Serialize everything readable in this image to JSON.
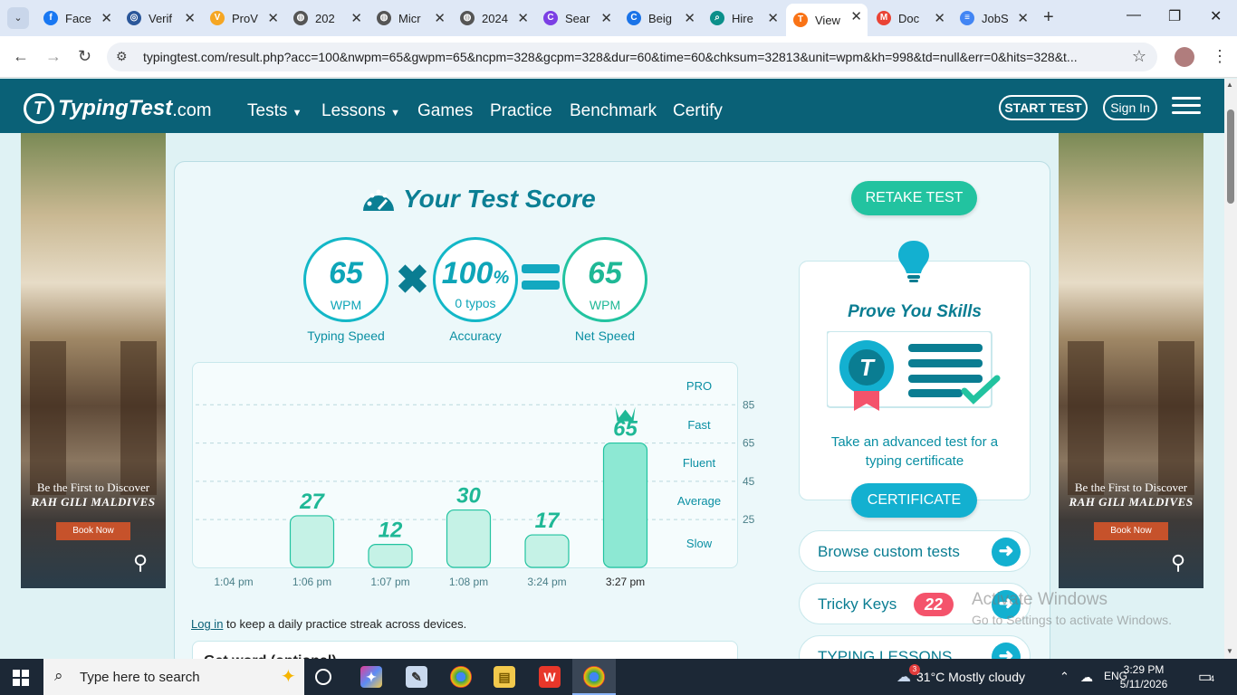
{
  "browser": {
    "tabs": [
      {
        "label": "Face",
        "color": "#1877f2",
        "glyph": "f"
      },
      {
        "label": "Verif",
        "color": "#2b579a",
        "glyph": "◎"
      },
      {
        "label": "ProV",
        "color": "#f5a623",
        "glyph": "V"
      },
      {
        "label": "202",
        "color": "#555555",
        "glyph": "◍"
      },
      {
        "label": "Micr",
        "color": "#555555",
        "glyph": "◍"
      },
      {
        "label": "2024",
        "color": "#555555",
        "glyph": "◍"
      },
      {
        "label": "Sear",
        "color": "#7b3fe4",
        "glyph": "C"
      },
      {
        "label": "Beig",
        "color": "#1a73e8",
        "glyph": "C"
      },
      {
        "label": "Hire",
        "color": "#0b8f8a",
        "glyph": "⌕"
      },
      {
        "label": "View",
        "color": "#f97316",
        "glyph": "T"
      },
      {
        "label": "Doc",
        "color": "#ea4335",
        "glyph": "M"
      },
      {
        "label": "JobS",
        "color": "#4285f4",
        "glyph": "≡"
      }
    ],
    "url": "typingtest.com/result.php?acc=100&nwpm=65&gwpm=65&ncpm=328&gcpm=328&dur=60&time=60&chksum=32813&unit=wpm&kh=998&td=null&err=0&hits=328&t..."
  },
  "site": {
    "logo_text": "TypingTest",
    "logo_domain": ".com",
    "nav": [
      "Tests",
      "Lessons",
      "Games",
      "Practice",
      "Benchmark",
      "Certify"
    ],
    "start_test": "START TEST",
    "sign_in": "Sign In"
  },
  "ads": {
    "line1": "Be the First to Discover",
    "line2": "RAH GILI MALDIVES",
    "button": "Book Now"
  },
  "score": {
    "title": "Your Test Score",
    "typing_speed": {
      "value": "65",
      "unit": "WPM",
      "label": "Typing Speed"
    },
    "accuracy": {
      "value": "100",
      "percent": "%",
      "sub": "0 typos",
      "label": "Accuracy"
    },
    "net_speed": {
      "value": "65",
      "unit": "WPM",
      "label": "Net Speed"
    }
  },
  "chart_data": {
    "type": "bar",
    "categories": [
      "1:04 pm",
      "1:06 pm",
      "1:07 pm",
      "1:08 pm",
      "3:24 pm",
      "3:27 pm"
    ],
    "values": [
      null,
      27,
      12,
      30,
      17,
      65
    ],
    "highlight_index": 5,
    "ylim": [
      0,
      105
    ],
    "y_ticks": [
      25,
      45,
      65,
      85
    ],
    "levels": [
      "PRO",
      "Fast",
      "Fluent",
      "Average",
      "Slow"
    ],
    "colors": {
      "bar": "#c5f2e6",
      "bar_stroke": "#22c3a0",
      "highlight": "#8de8d3",
      "label": "#1fb896"
    }
  },
  "right": {
    "retake": "RETAKE TEST",
    "prove_title": "Prove You Skills",
    "prove_desc": "Take an advanced test for a typing certificate",
    "certificate": "CERTIFICATE",
    "links": [
      {
        "label": "Browse custom tests"
      },
      {
        "label": "Tricky Keys",
        "badge": "22"
      },
      {
        "label": "TYPING LESSONS"
      }
    ]
  },
  "login_link": "Log in",
  "login_text": " to keep a daily practice streak across devices.",
  "bottom_title": "Get word (optional)",
  "watermark": {
    "line1": "Activate Windows",
    "line2": "Go to Settings to activate Windows."
  },
  "taskbar": {
    "search_placeholder": "Type here to search",
    "weather": "31°C  Mostly cloudy",
    "weather_badge": "3",
    "lang": "ENG",
    "time": "3:29 PM",
    "date": "5/11/2026",
    "notif_count": "4"
  }
}
